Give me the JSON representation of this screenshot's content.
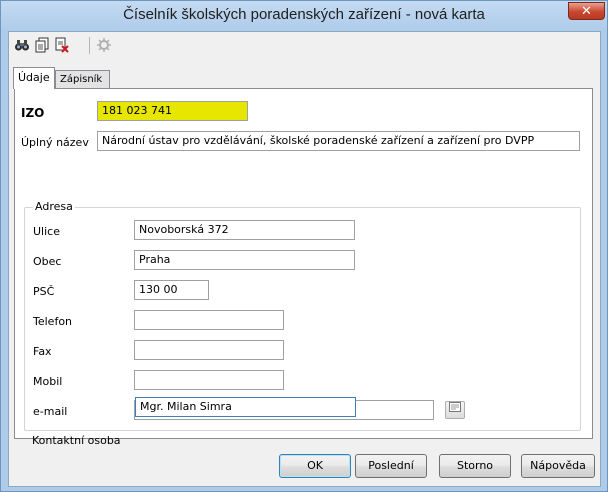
{
  "window": {
    "title": "Číselník školských poradenských zařízení - nová karta",
    "close_glyph": "✕"
  },
  "toolbar": {
    "icons": [
      "binoculars-icon",
      "copy-document-icon",
      "delete-document-icon",
      "settings-disabled-icon"
    ]
  },
  "tabs": [
    {
      "label": "Údaje",
      "active": true
    },
    {
      "label": "Zápisník",
      "active": false
    }
  ],
  "form": {
    "izo_label": "IZO",
    "izo_value": "181 023 741",
    "full_name_label": "Úplný název",
    "full_name_value": "Národní ústav pro vzdělávání, školské poradenské zařízení a zařízení pro DVPP",
    "address_group_title": "Adresa",
    "street_label": "Ulice",
    "street_value": "Novoborská 372",
    "city_label": "Obec",
    "city_value": "Praha",
    "zip_label": "PSČ",
    "zip_value": "130 00",
    "phone_label": "Telefon",
    "phone_value": "",
    "fax_label": "Fax",
    "fax_value": "",
    "mobile_label": "Mobil",
    "mobile_value": "",
    "email_label": "e-mail",
    "email_value": "",
    "contact_label": "Kontaktní osoba",
    "contact_value": "Mgr. Milan Simra"
  },
  "buttons": {
    "ok": "OK",
    "last": "Poslední",
    "cancel": "Storno",
    "help": "Nápověda"
  },
  "colors": {
    "izo_highlight": "#e6e600",
    "title_bar": "#aecbea",
    "close_button": "#c9462f"
  }
}
